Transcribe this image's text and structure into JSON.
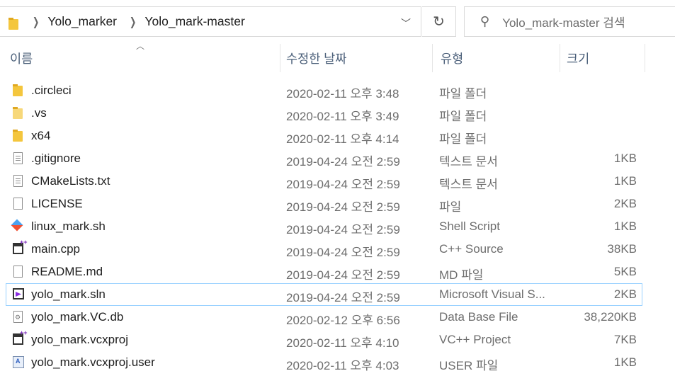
{
  "address": {
    "crumbs": [
      "Yolo_marker",
      "Yolo_mark-master"
    ],
    "search_placeholder": "Yolo_mark-master 검색"
  },
  "columns": {
    "name": "이름",
    "date": "수정한 날짜",
    "type": "유형",
    "size": "크기"
  },
  "files": [
    {
      "name": ".circleci",
      "date": "2020-02-11 오후 3:48",
      "type": "파일 폴더",
      "size": "",
      "icon": "folder-icon"
    },
    {
      "name": ".vs",
      "date": "2020-02-11 오후 3:49",
      "type": "파일 폴더",
      "size": "",
      "icon": "folder-light-icon"
    },
    {
      "name": "x64",
      "date": "2020-02-11 오후 4:14",
      "type": "파일 폴더",
      "size": "",
      "icon": "folder-icon"
    },
    {
      "name": ".gitignore",
      "date": "2019-04-24 오전 2:59",
      "type": "텍스트 문서",
      "size": "1KB",
      "icon": "text-file-icon"
    },
    {
      "name": "CMakeLists.txt",
      "date": "2019-04-24 오전 2:59",
      "type": "텍스트 문서",
      "size": "1KB",
      "icon": "text-file-icon"
    },
    {
      "name": "LICENSE",
      "date": "2019-04-24 오전 2:59",
      "type": "파일",
      "size": "2KB",
      "icon": "blank-file-icon"
    },
    {
      "name": "linux_mark.sh",
      "date": "2019-04-24 오전 2:59",
      "type": "Shell Script",
      "size": "1KB",
      "icon": "git-script-icon"
    },
    {
      "name": "main.cpp",
      "date": "2019-04-24 오전 2:59",
      "type": "C++ Source",
      "size": "38KB",
      "icon": "cpp-file-icon"
    },
    {
      "name": "README.md",
      "date": "2019-04-24 오전 2:59",
      "type": "MD 파일",
      "size": "5KB",
      "icon": "blank-file-icon"
    },
    {
      "name": "yolo_mark.sln",
      "date": "2019-04-24 오전 2:59",
      "type": "Microsoft Visual S...",
      "size": "2KB",
      "icon": "visual-studio-icon"
    },
    {
      "name": "yolo_mark.VC.db",
      "date": "2020-02-12 오후 6:56",
      "type": "Data Base File",
      "size": "38,220KB",
      "icon": "database-file-icon"
    },
    {
      "name": "yolo_mark.vcxproj",
      "date": "2020-02-11 오후 4:10",
      "type": "VC++ Project",
      "size": "7KB",
      "icon": "vcxproj-icon"
    },
    {
      "name": "yolo_mark.vcxproj.user",
      "date": "2020-02-11 오후 4:03",
      "type": "USER 파일",
      "size": "1KB",
      "icon": "user-file-icon"
    }
  ]
}
